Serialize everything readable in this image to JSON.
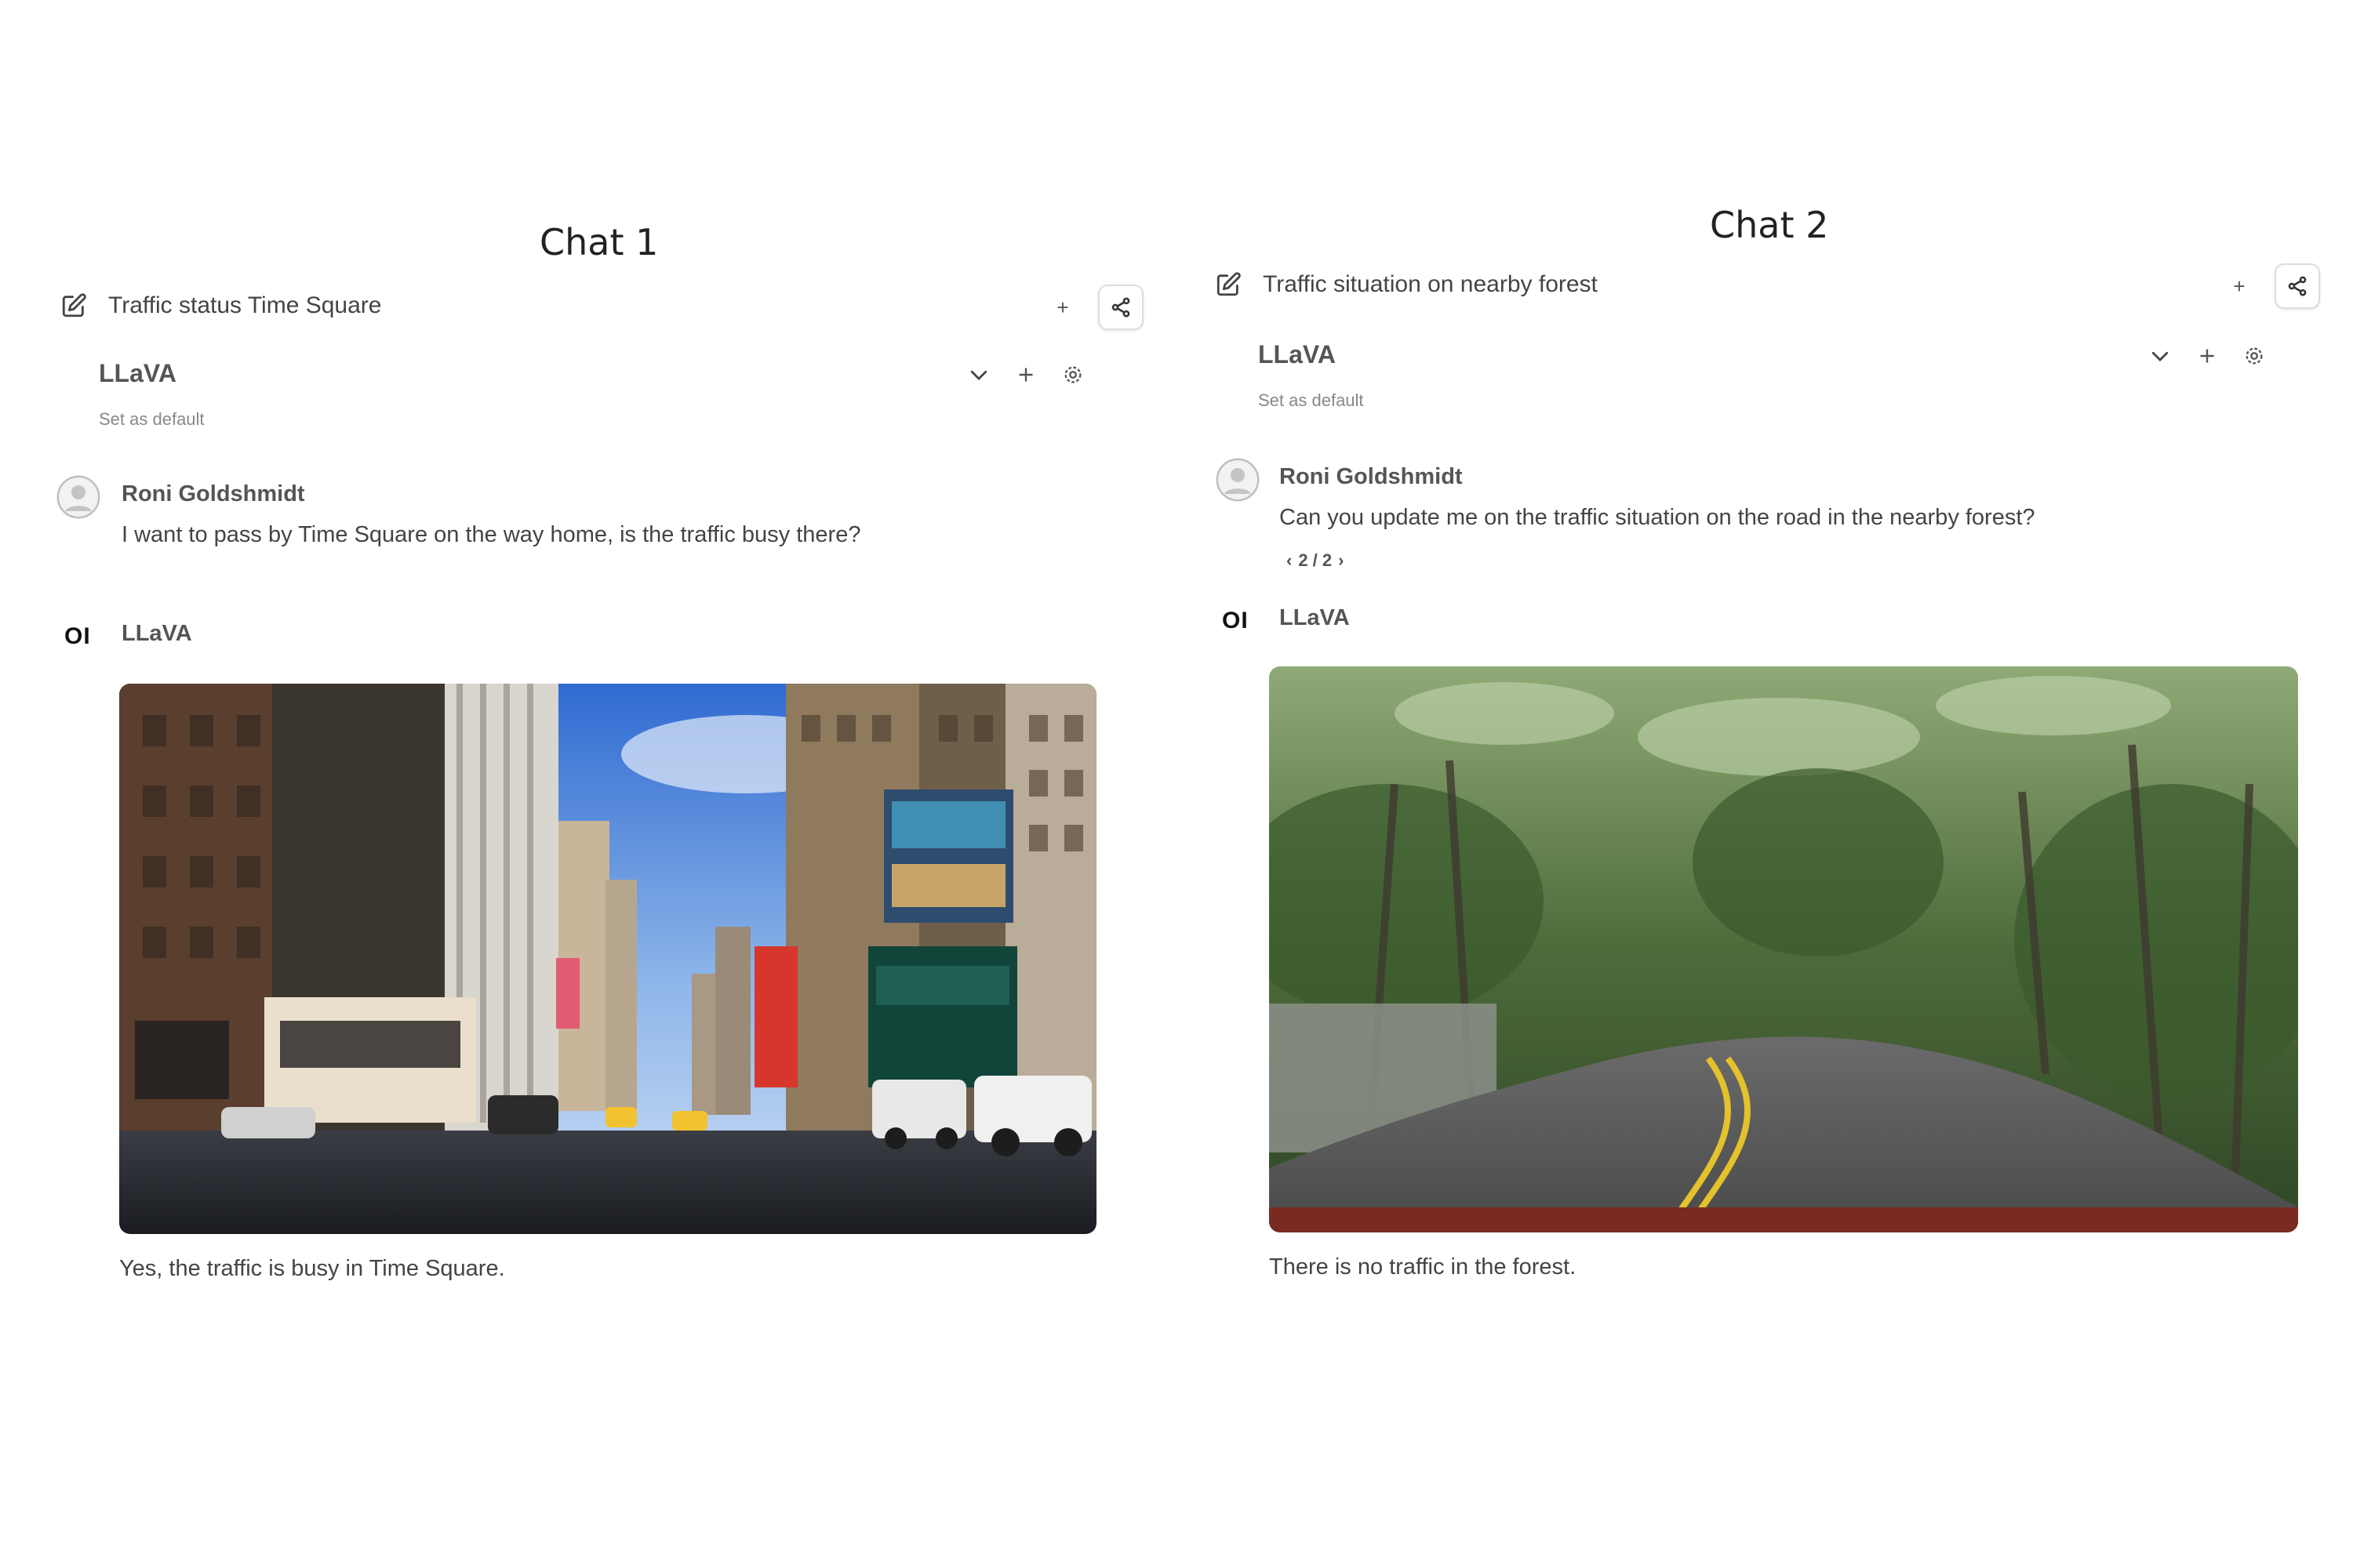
{
  "chat1": {
    "label": "Chat 1",
    "title": "Traffic status Time Square",
    "model": "LLaVA",
    "set_default": "Set as default",
    "user_name": "Roni Goldshmidt",
    "user_message": "I want to pass by Time Square on the way home, is the traffic busy there?",
    "bot_logo": "OI",
    "bot_name": "LLaVA",
    "reply": "Yes, the traffic is busy in Time Square."
  },
  "chat2": {
    "label": "Chat 2",
    "title": "Traffic situation on nearby forest",
    "model": "LLaVA",
    "set_default": "Set as default",
    "user_name": "Roni Goldshmidt",
    "user_message": "Can you update me on the traffic situation on the road in the nearby forest?",
    "pager": "2 / 2",
    "bot_logo": "OI",
    "bot_name": "LLaVA",
    "reply": "There is no traffic in the forest."
  },
  "icons": [
    "edit-icon",
    "plus-icon",
    "share-icon",
    "chevron-down-icon",
    "gear-icon",
    "user-avatar-icon"
  ]
}
